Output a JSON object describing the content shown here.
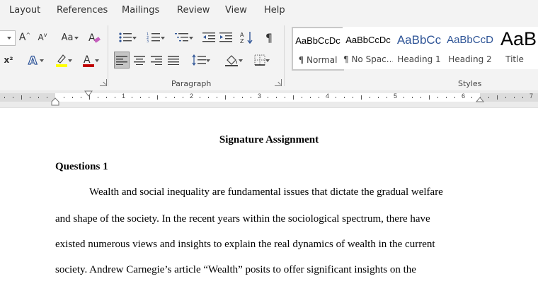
{
  "ribbon_tabs": [
    "Layout",
    "References",
    "Mailings",
    "Review",
    "View",
    "Help"
  ],
  "groups": {
    "paragraph": "Paragraph",
    "styles": "Styles"
  },
  "styles_gallery": [
    {
      "sample": "AaBbCcDc",
      "name": "¶ Normal",
      "color": "#000000"
    },
    {
      "sample": "AaBbCcDc",
      "name": "¶ No Spac...",
      "color": "#000000"
    },
    {
      "sample": "AaBbCc",
      "name": "Heading 1",
      "color": "#2f5597"
    },
    {
      "sample": "AaBbCcD",
      "name": "Heading 2",
      "color": "#2f5597"
    },
    {
      "sample": "AaB",
      "name": "Title",
      "color": "#000000"
    }
  ],
  "font_buttons": {
    "grow": "A",
    "shrink": "A",
    "case": "Aa",
    "superscript": "x²"
  },
  "ruler_numbers": [
    "1",
    "2",
    "3",
    "4",
    "5",
    "6",
    "7"
  ],
  "colors": {
    "highlight": "#ffff00",
    "font_color": "#c00000",
    "accent": "#2f5597"
  },
  "document": {
    "title": "Signature Assignment",
    "heading": "Questions 1",
    "lines": [
      "Wealth and social inequality are fundamental issues that dictate the gradual welfare",
      "and shape of the society. In the recent years within the sociological spectrum, there have",
      "existed numerous views and insights to explain the real dynamics of wealth in the current",
      "society. Andrew Carnegie’s article “Wealth” posits to offer significant insights on the"
    ]
  }
}
